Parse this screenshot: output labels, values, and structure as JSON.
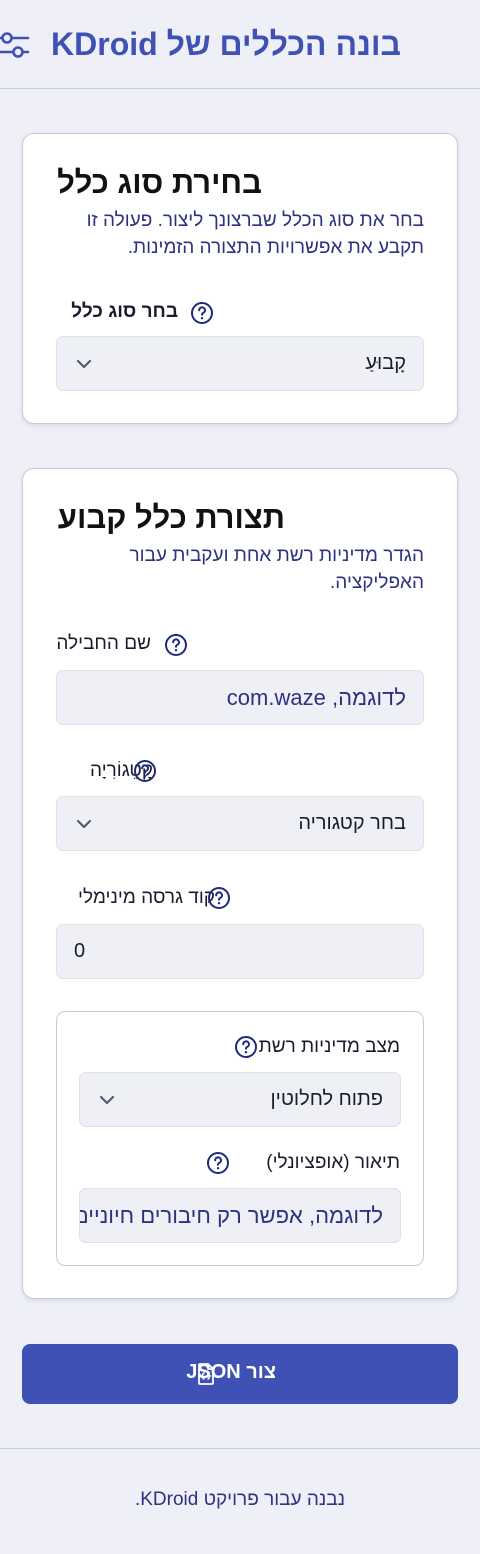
{
  "header": {
    "title": "בונה הכללים של KDroid",
    "icon": "sliders-icon"
  },
  "rule_type_card": {
    "title": "בחירת סוג כלל",
    "description": "בחר את סוג הכלל שברצונך ליצור. פעולה זו תקבע את אפשרויות התצורה הזמינות.",
    "field_label": "בחר סוג כלל",
    "selected_value": "קָבוּעַ"
  },
  "fixed_rule_card": {
    "title": "תצורת כלל קבוע",
    "description": "הגדר מדיניות רשת אחת ועקבית עבור האפליקציה.",
    "package_label": "שם החבילה",
    "package_placeholder": "לדוגמה, com.waze",
    "category_label": "קָטֵגוֹרִיָה",
    "category_value": "בחר קטגוריה",
    "min_version_label": "קוד גרסה מינימלי",
    "min_version_value": "0",
    "network_policy": {
      "mode_label": "מצב מדיניות רשת",
      "mode_value": "פתוח לחלוטין",
      "description_label": "תיאור (אופציונלי)",
      "description_placeholder": "לדוגמה, אפשר רק חיבורים חיוניים"
    }
  },
  "generate_button": {
    "label": "צור JSON",
    "icon": "json-file-icon"
  },
  "footer": {
    "text": "נבנה עבור פרויקט KDroid."
  },
  "colors": {
    "primary": "#3f51b5",
    "background": "#eff0f7",
    "text_accent": "#2c3280"
  }
}
